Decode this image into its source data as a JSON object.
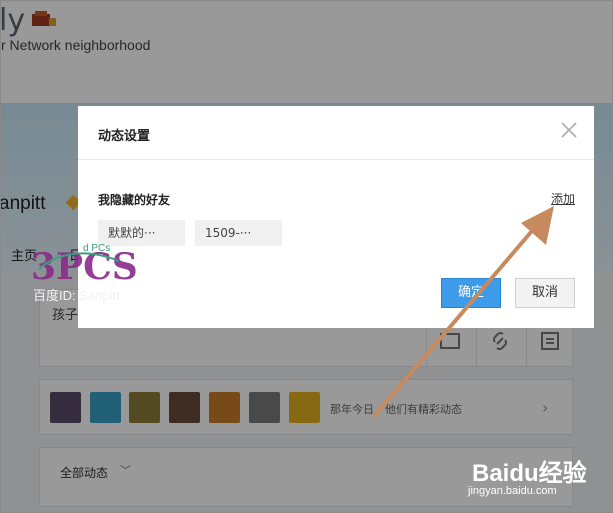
{
  "background": {
    "brand_fragment": "ly",
    "tagline": "r Network neighborhood",
    "username": "anpitt",
    "nav": {
      "home": "主页",
      "next": "日"
    },
    "post_placeholder": "孩子",
    "friends_bar": {
      "memory_text": "那年今日，他们有精彩动态"
    },
    "feed_filter": "全部动态"
  },
  "modal": {
    "title": "动态设置",
    "section_label": "我隐藏的好友",
    "add_link": "添加",
    "hidden_friends": [
      "默默的···",
      "1509-···"
    ],
    "confirm_button": "确定",
    "cancel_button": "取消"
  },
  "watermark": {
    "logo_text": "3PCS",
    "logo_sub": "d PCs",
    "baidu_id": "百度ID: Sanpitt",
    "baidu_logo": "Baidu经验",
    "url": "jingyan.baidu.com"
  },
  "colors": {
    "primary_button": "#3d9be9",
    "arrow": "#c78a5e",
    "banner": "#c7e6f6"
  }
}
